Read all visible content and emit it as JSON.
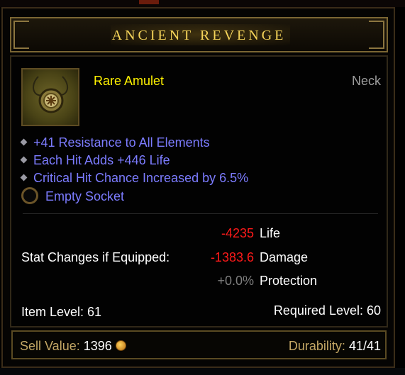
{
  "item": {
    "name": "ANCIENT REVENGE",
    "type": "Rare Amulet",
    "slot": "Neck",
    "icon": "amulet-icon"
  },
  "affixes": [
    "+41 Resistance to All Elements",
    "Each Hit Adds +446 Life",
    "Critical Hit Chance Increased by 6.5%"
  ],
  "socket": {
    "label": "Empty Socket",
    "icon": "empty-socket-icon"
  },
  "stat_changes": {
    "label": "Stat Changes if Equipped:",
    "rows": [
      {
        "value": "-4235",
        "name": "Life",
        "color": "#ff1a1a"
      },
      {
        "value": "-1383.6",
        "name": "Damage",
        "color": "#ff1a1a"
      },
      {
        "value": "+0.0%",
        "name": "Protection",
        "color": "#7f7f7f"
      }
    ]
  },
  "levels": {
    "item_level": "Item Level: 61",
    "required_level": "Required Level: 60"
  },
  "footer": {
    "sell_label": "Sell Value:",
    "sell_amount": "1396",
    "durability_label": "Durability:",
    "durability_value": "41/41",
    "coin_icon": "gold-coin-icon"
  },
  "colors": {
    "title": "#f6d55a",
    "rare": "#fff200",
    "magic_affix": "#7c7cff",
    "negative": "#ff1a1a",
    "neutral": "#7f7f7f",
    "footer_label": "#c4a765"
  }
}
